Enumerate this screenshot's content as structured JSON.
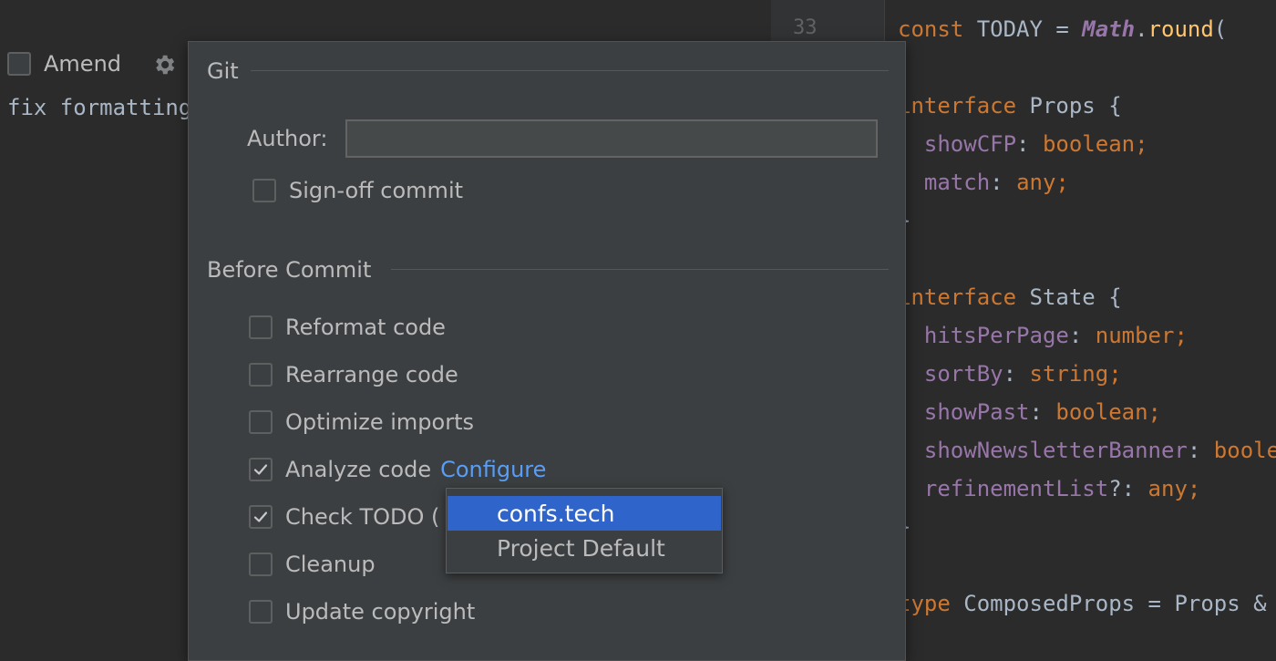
{
  "commit_panel": {
    "amend_label": "Amend",
    "commit_message": "fix formatting"
  },
  "gutter": {
    "line_number": "33"
  },
  "editor": {
    "lines": [
      {
        "parts": [
          [
            "kw",
            "const "
          ],
          [
            "plain",
            "TODAY = "
          ],
          [
            "italic",
            "Math"
          ],
          [
            "plain",
            "."
          ],
          [
            "fn",
            "round"
          ],
          [
            "plain",
            "( "
          ]
        ]
      },
      {
        "parts": [
          [
            "kw",
            "interface "
          ],
          [
            "plain",
            "Props {"
          ]
        ]
      },
      {
        "parts": [
          [
            "prop",
            "  showCFP"
          ],
          [
            "plain",
            ": "
          ],
          [
            "kw",
            "boolean;"
          ]
        ]
      },
      {
        "parts": [
          [
            "prop",
            "  match"
          ],
          [
            "plain",
            ": "
          ],
          [
            "kw",
            "any;"
          ]
        ]
      },
      {
        "parts": [
          [
            "plain",
            "}"
          ]
        ]
      },
      {
        "parts": [
          [
            "kw",
            "interface "
          ],
          [
            "plain",
            "State {"
          ]
        ]
      },
      {
        "parts": [
          [
            "prop",
            "  hitsPerPage"
          ],
          [
            "plain",
            ": "
          ],
          [
            "kw",
            "number;"
          ]
        ]
      },
      {
        "parts": [
          [
            "prop",
            "  sortBy"
          ],
          [
            "plain",
            ": "
          ],
          [
            "kw",
            "string;"
          ]
        ]
      },
      {
        "parts": [
          [
            "prop",
            "  showPast"
          ],
          [
            "plain",
            ": "
          ],
          [
            "kw",
            "boolean;"
          ]
        ]
      },
      {
        "parts": [
          [
            "prop",
            "  showNewsletterBanner"
          ],
          [
            "plain",
            ": "
          ],
          [
            "kw",
            "boolean;"
          ]
        ]
      },
      {
        "parts": [
          [
            "prop",
            "  refinementList"
          ],
          [
            "plain",
            "?: "
          ],
          [
            "kw",
            "any;"
          ]
        ]
      },
      {
        "parts": [
          [
            "plain",
            "}"
          ]
        ]
      },
      {
        "parts": [
          [
            "kw",
            "type "
          ],
          [
            "plain",
            "ComposedProps = Props & "
          ]
        ]
      }
    ]
  },
  "popup": {
    "git_section_title": "Git",
    "author_label": "Author:",
    "author_value": "",
    "signoff_label": "Sign-off commit",
    "before_commit_title": "Before Commit",
    "options": [
      {
        "label": "Reformat code",
        "checked": false
      },
      {
        "label": "Rearrange code",
        "checked": false
      },
      {
        "label": "Optimize imports",
        "checked": false
      },
      {
        "label": "Analyze code",
        "checked": true,
        "link": "Configure"
      },
      {
        "label": "Check TODO (",
        "checked": true
      },
      {
        "label": "Cleanup",
        "checked": false
      },
      {
        "label": "Update copyright",
        "checked": false
      }
    ]
  },
  "dropdown": {
    "items": [
      "confs.tech",
      "Project Default"
    ],
    "selected": 0
  },
  "colors": {
    "selection": "#2f65ca",
    "link": "#589df6",
    "keyword": "#cc7832",
    "property": "#9876aa"
  }
}
